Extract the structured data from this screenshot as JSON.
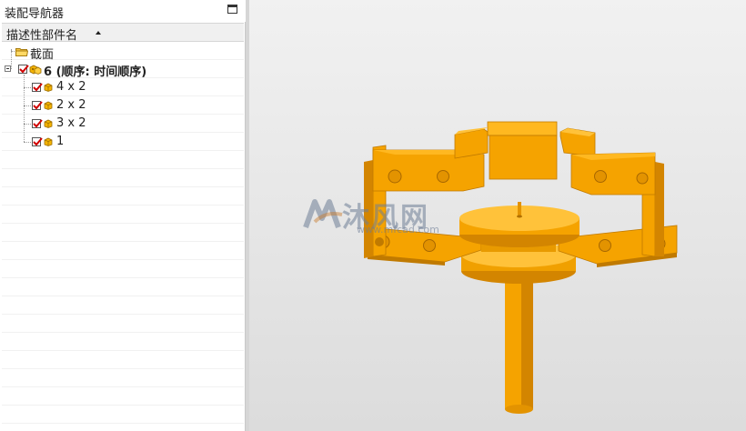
{
  "navigator": {
    "title": "装配导航器",
    "column_header": "描述性部件名",
    "rows": [
      {
        "label": "截面",
        "type": "folder"
      },
      {
        "label": "6 (顺序: 时间顺序)",
        "type": "assembly",
        "checked": true,
        "expanded": true
      },
      {
        "label": "4 x 2",
        "type": "part",
        "checked": true
      },
      {
        "label": "2 x 2",
        "type": "part",
        "checked": true
      },
      {
        "label": "3 x 2",
        "type": "part",
        "checked": true
      },
      {
        "label": "1",
        "type": "part",
        "checked": true
      }
    ]
  },
  "watermark": {
    "text": "沐风网",
    "sub": "www.mfcad.com"
  },
  "colors": {
    "part_orange": "#f5a300",
    "part_orange_dark": "#d38500",
    "part_orange_light": "#ffc23a",
    "checkbox_red": "#d00000",
    "viewport_bg_top": "#f1f1f1",
    "viewport_bg_bottom": "#dcdcdc"
  }
}
